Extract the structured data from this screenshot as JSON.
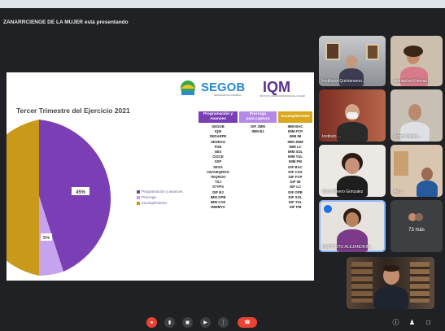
{
  "meeting": {
    "presenter_banner": "ZANARRCIENGE DE LA MUJER está presentando"
  },
  "slide": {
    "title": "Tercer Trimestre del Ejercicio 2021",
    "logo": {
      "segob": "SEGOB",
      "segob_sub": "SECRETARÍA DE GOBIERNO",
      "iqm": "IQM",
      "iqm_sub": "INSTITUTO QUINTANARROENSE DE LA MUJER"
    },
    "pie_labels": [
      "45%",
      "5%"
    ],
    "legend": [
      "Programación y avances",
      "Prorroga",
      "Incumplimiento"
    ],
    "columns": [
      {
        "header_l1": "Programación y",
        "header_l2": "Avances",
        "rows": [
          "SEGOB",
          "IQM",
          "SEDARPE",
          "SEDESO",
          "FGE",
          "SES",
          "CIGCE",
          "SSP",
          "SESA",
          "CEAVEQROO",
          "TEQROO",
          "TSJ",
          "STYPS",
          "DIF BJ",
          "IMM OPB",
          "IMM COZ",
          "IMMMYA"
        ]
      },
      {
        "header_l1": "Prorroga",
        "header_l2": "para captura",
        "rows": [
          "DIF JMM",
          "IMM BJ"
        ]
      },
      {
        "header_l1": "Incumplimiento",
        "header_l2": "",
        "rows": [
          "IMM BAC",
          "IMM FCP",
          "IMM IM",
          "IMM JMM",
          "IMM LC",
          "IMM SOL",
          "IMM TUL",
          "IMM PM",
          "DIF BAC",
          "DIF COZ",
          "DIF FCP",
          "DIF IM",
          "DIF LC",
          "DIF OPB",
          "DIF SOL",
          "DIF TUL",
          "DIF PM"
        ]
      }
    ]
  },
  "participants": [
    {
      "name": "Institutos Quintanaroo..."
    },
    {
      "name": "mariaelisa Kleman..."
    },
    {
      "name": "Instituto ..."
    },
    {
      "name": "Arturo Castro..."
    },
    {
      "name": "Nuria Rivero Gonzalez"
    },
    {
      "name": "Ana..."
    },
    {
      "name": "INSTITUTO ALEJANDRIN..."
    },
    {
      "name": ""
    }
  ],
  "more_participants": "73 más",
  "colors": {
    "purple": "#7b3fb5",
    "lavender": "#c7a3ef",
    "gold": "#c99a1a",
    "segob_blue": "#2a8bd0",
    "iqm_purple": "#5a2d91"
  }
}
